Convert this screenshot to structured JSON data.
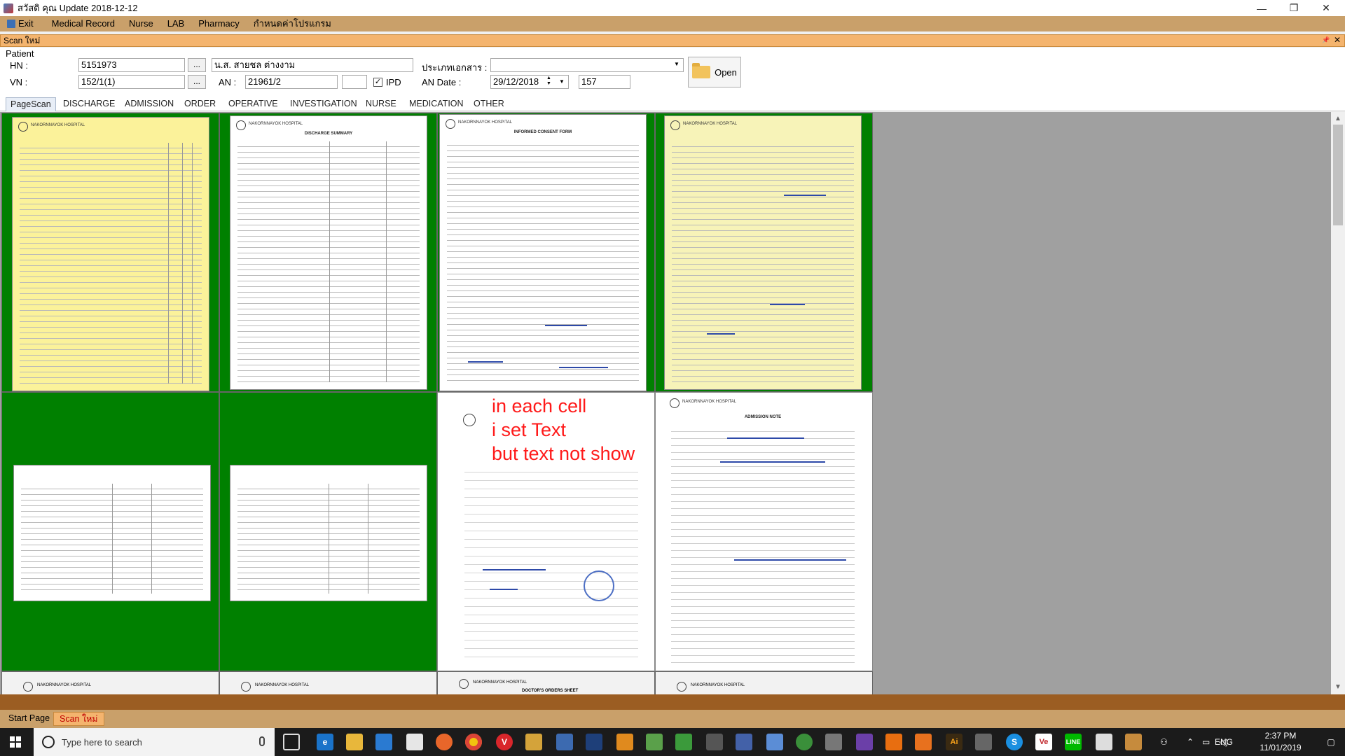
{
  "window": {
    "title": "สวัสดิ คุณ   Update 2018-12-12",
    "minimize": "—",
    "maximize": "❐",
    "close": "✕"
  },
  "menu": {
    "items": [
      "Exit",
      "Medical Record",
      "Nurse",
      "LAB",
      "Pharmacy",
      "กำหนดค่าโปรแกรม"
    ]
  },
  "doc_header": {
    "label": "Scan ใหม่",
    "pin": "📌",
    "close": "✕"
  },
  "patient": {
    "group_label": "Patient",
    "hn_label": "HN :",
    "hn_value": "5151973",
    "hn_browse": "...",
    "patient_name": "น.ส. สายชล ต่างงาม",
    "vn_label": "VN :",
    "vn_value": "152/1(1)",
    "vn_browse": "...",
    "an_label": "AN :",
    "an_value": "21961/2",
    "an_extra": "",
    "ipd_checked": "✓",
    "ipd_label": "IPD",
    "doctype_label": "ประเภทเอกสาร :",
    "doctype_value": "",
    "an_date_label": "AN Date :",
    "an_date_value": "29/12/2018",
    "an_number": "157",
    "open_label": "Open"
  },
  "tabs": [
    "PageScan",
    "DISCHARGE",
    "ADMISSION",
    "ORDER",
    "OPERATIVE",
    "INVESTIGATION",
    "NURSE",
    "MEDICATION",
    "OTHER"
  ],
  "documents": {
    "row1": [
      "",
      "DISCHARGE SUMMARY",
      "INFORMED CONSENT FORM",
      ""
    ],
    "row2": [
      "",
      "",
      "",
      "ADMISSION NOTE"
    ],
    "row3": [
      "",
      "",
      "DOCTOR'S ORDERS SHEET",
      ""
    ],
    "hospital": "NAKORNNAYOK HOSPITAL"
  },
  "overlay": {
    "line1": "in each cell",
    "line2": "i set Text",
    "line3": "but text not show"
  },
  "bottom_tabs": [
    "Start Page",
    "Scan ใหม่"
  ],
  "taskbar": {
    "search_placeholder": "Type here to search",
    "language": "ENG",
    "time": "2:37 PM",
    "date": "11/01/2019"
  },
  "colors": {
    "menu": "#c9a06a",
    "cell_green": "#008000",
    "overlay": "#ff1a1a"
  }
}
